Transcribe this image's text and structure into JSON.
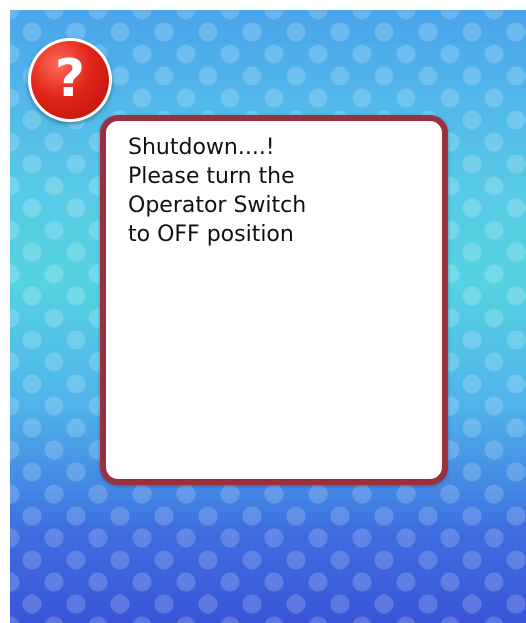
{
  "help_button": {
    "glyph": "?",
    "icon": "question-mark-icon",
    "color": "#e02418"
  },
  "message": {
    "text": "Shutdown....!\nPlease turn the\nOperator Switch\nto OFF position",
    "border_color": "#9a2f3e"
  }
}
